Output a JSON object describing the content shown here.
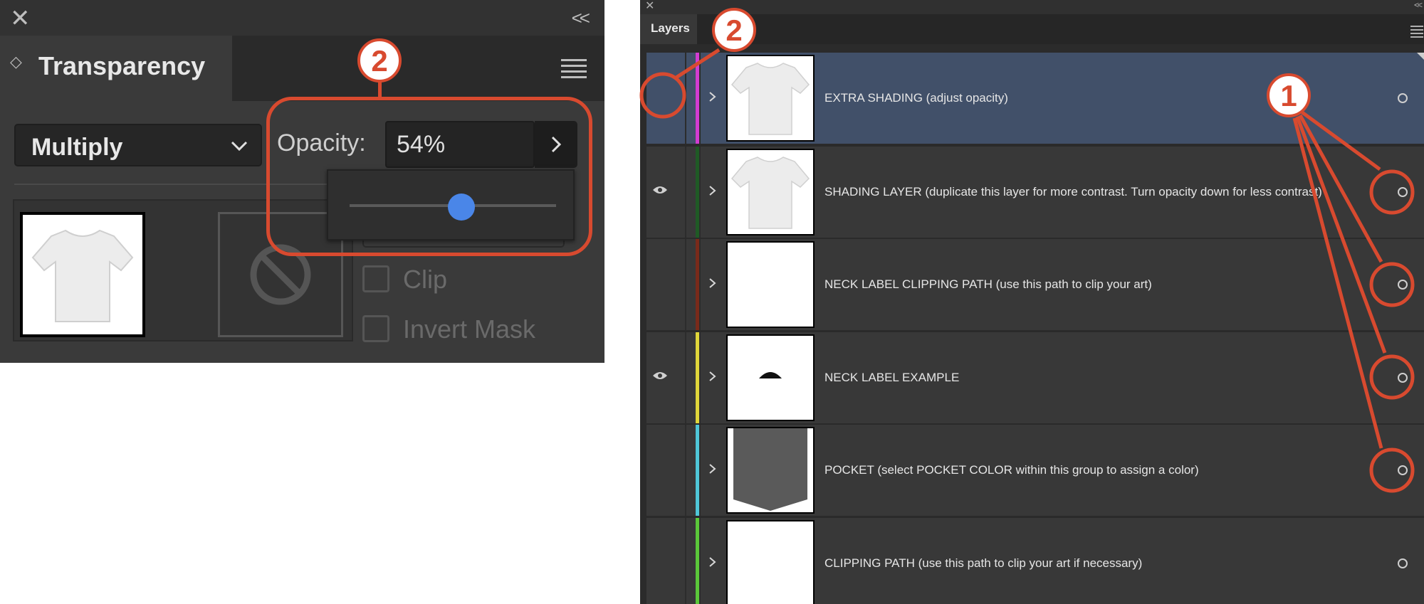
{
  "transparency": {
    "title": "Transparency",
    "blend_mode": "Multiply",
    "opacity_label": "Opacity:",
    "opacity_value": "54%",
    "opacity_fraction": 0.54,
    "clip_label": "Clip",
    "invert_mask_label": "Invert Mask",
    "clip_checked": false,
    "invert_mask_checked": false
  },
  "layers_panel": {
    "tab_label": "Layers",
    "layers": [
      {
        "name": "EXTRA SHADING (adjust opacity)",
        "visible": false,
        "selected": true,
        "color": "#d23cd2",
        "thumbnail": "tshirt"
      },
      {
        "name": "SHADING LAYER (duplicate this layer for more contrast. Turn opacity down for less contrast)",
        "visible": true,
        "selected": false,
        "color": "#1f5a25",
        "thumbnail": "tshirt"
      },
      {
        "name": "NECK LABEL CLIPPING PATH (use this path to clip your art)",
        "visible": false,
        "selected": false,
        "color": "#7a2a1a",
        "thumbnail": "blank"
      },
      {
        "name": "NECK LABEL EXAMPLE",
        "visible": true,
        "selected": false,
        "color": "#e0d63a",
        "thumbnail": "neck-label"
      },
      {
        "name": "POCKET (select POCKET COLOR within this group to assign a color)",
        "visible": false,
        "selected": false,
        "color": "#4fc6d8",
        "thumbnail": "pocket"
      },
      {
        "name": "CLIPPING PATH (use this path to clip your art if necessary)",
        "visible": false,
        "selected": false,
        "color": "#5bc83a",
        "thumbnail": "blank"
      }
    ]
  },
  "annotations": {
    "badge_1": "1",
    "badge_2_transparency": "2",
    "badge_2_layers": "2",
    "accent_color": "#d84a2f"
  }
}
